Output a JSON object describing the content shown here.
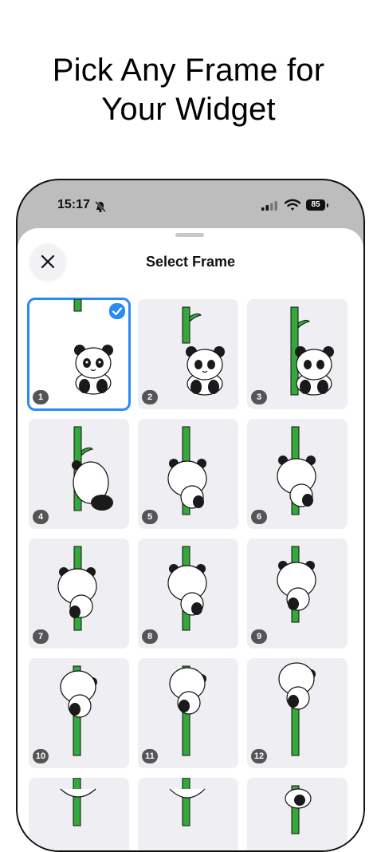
{
  "headline": {
    "line1": "Pick Any Frame for",
    "line2": "Your Widget"
  },
  "status_bar": {
    "time": "15:17",
    "battery": "85",
    "icons": [
      "bell-slash-icon",
      "signal-icon",
      "wifi-icon",
      "battery-icon"
    ]
  },
  "sheet": {
    "title": "Select Frame",
    "close_icon": "close-icon"
  },
  "frames": {
    "selected": 1,
    "labels": [
      "1",
      "2",
      "3",
      "4",
      "5",
      "6",
      "7",
      "8",
      "9",
      "10",
      "11",
      "12"
    ]
  },
  "colors": {
    "accent": "#2a8af6",
    "bamboo": "#34a83a",
    "tile_bg": "#efeff3"
  }
}
